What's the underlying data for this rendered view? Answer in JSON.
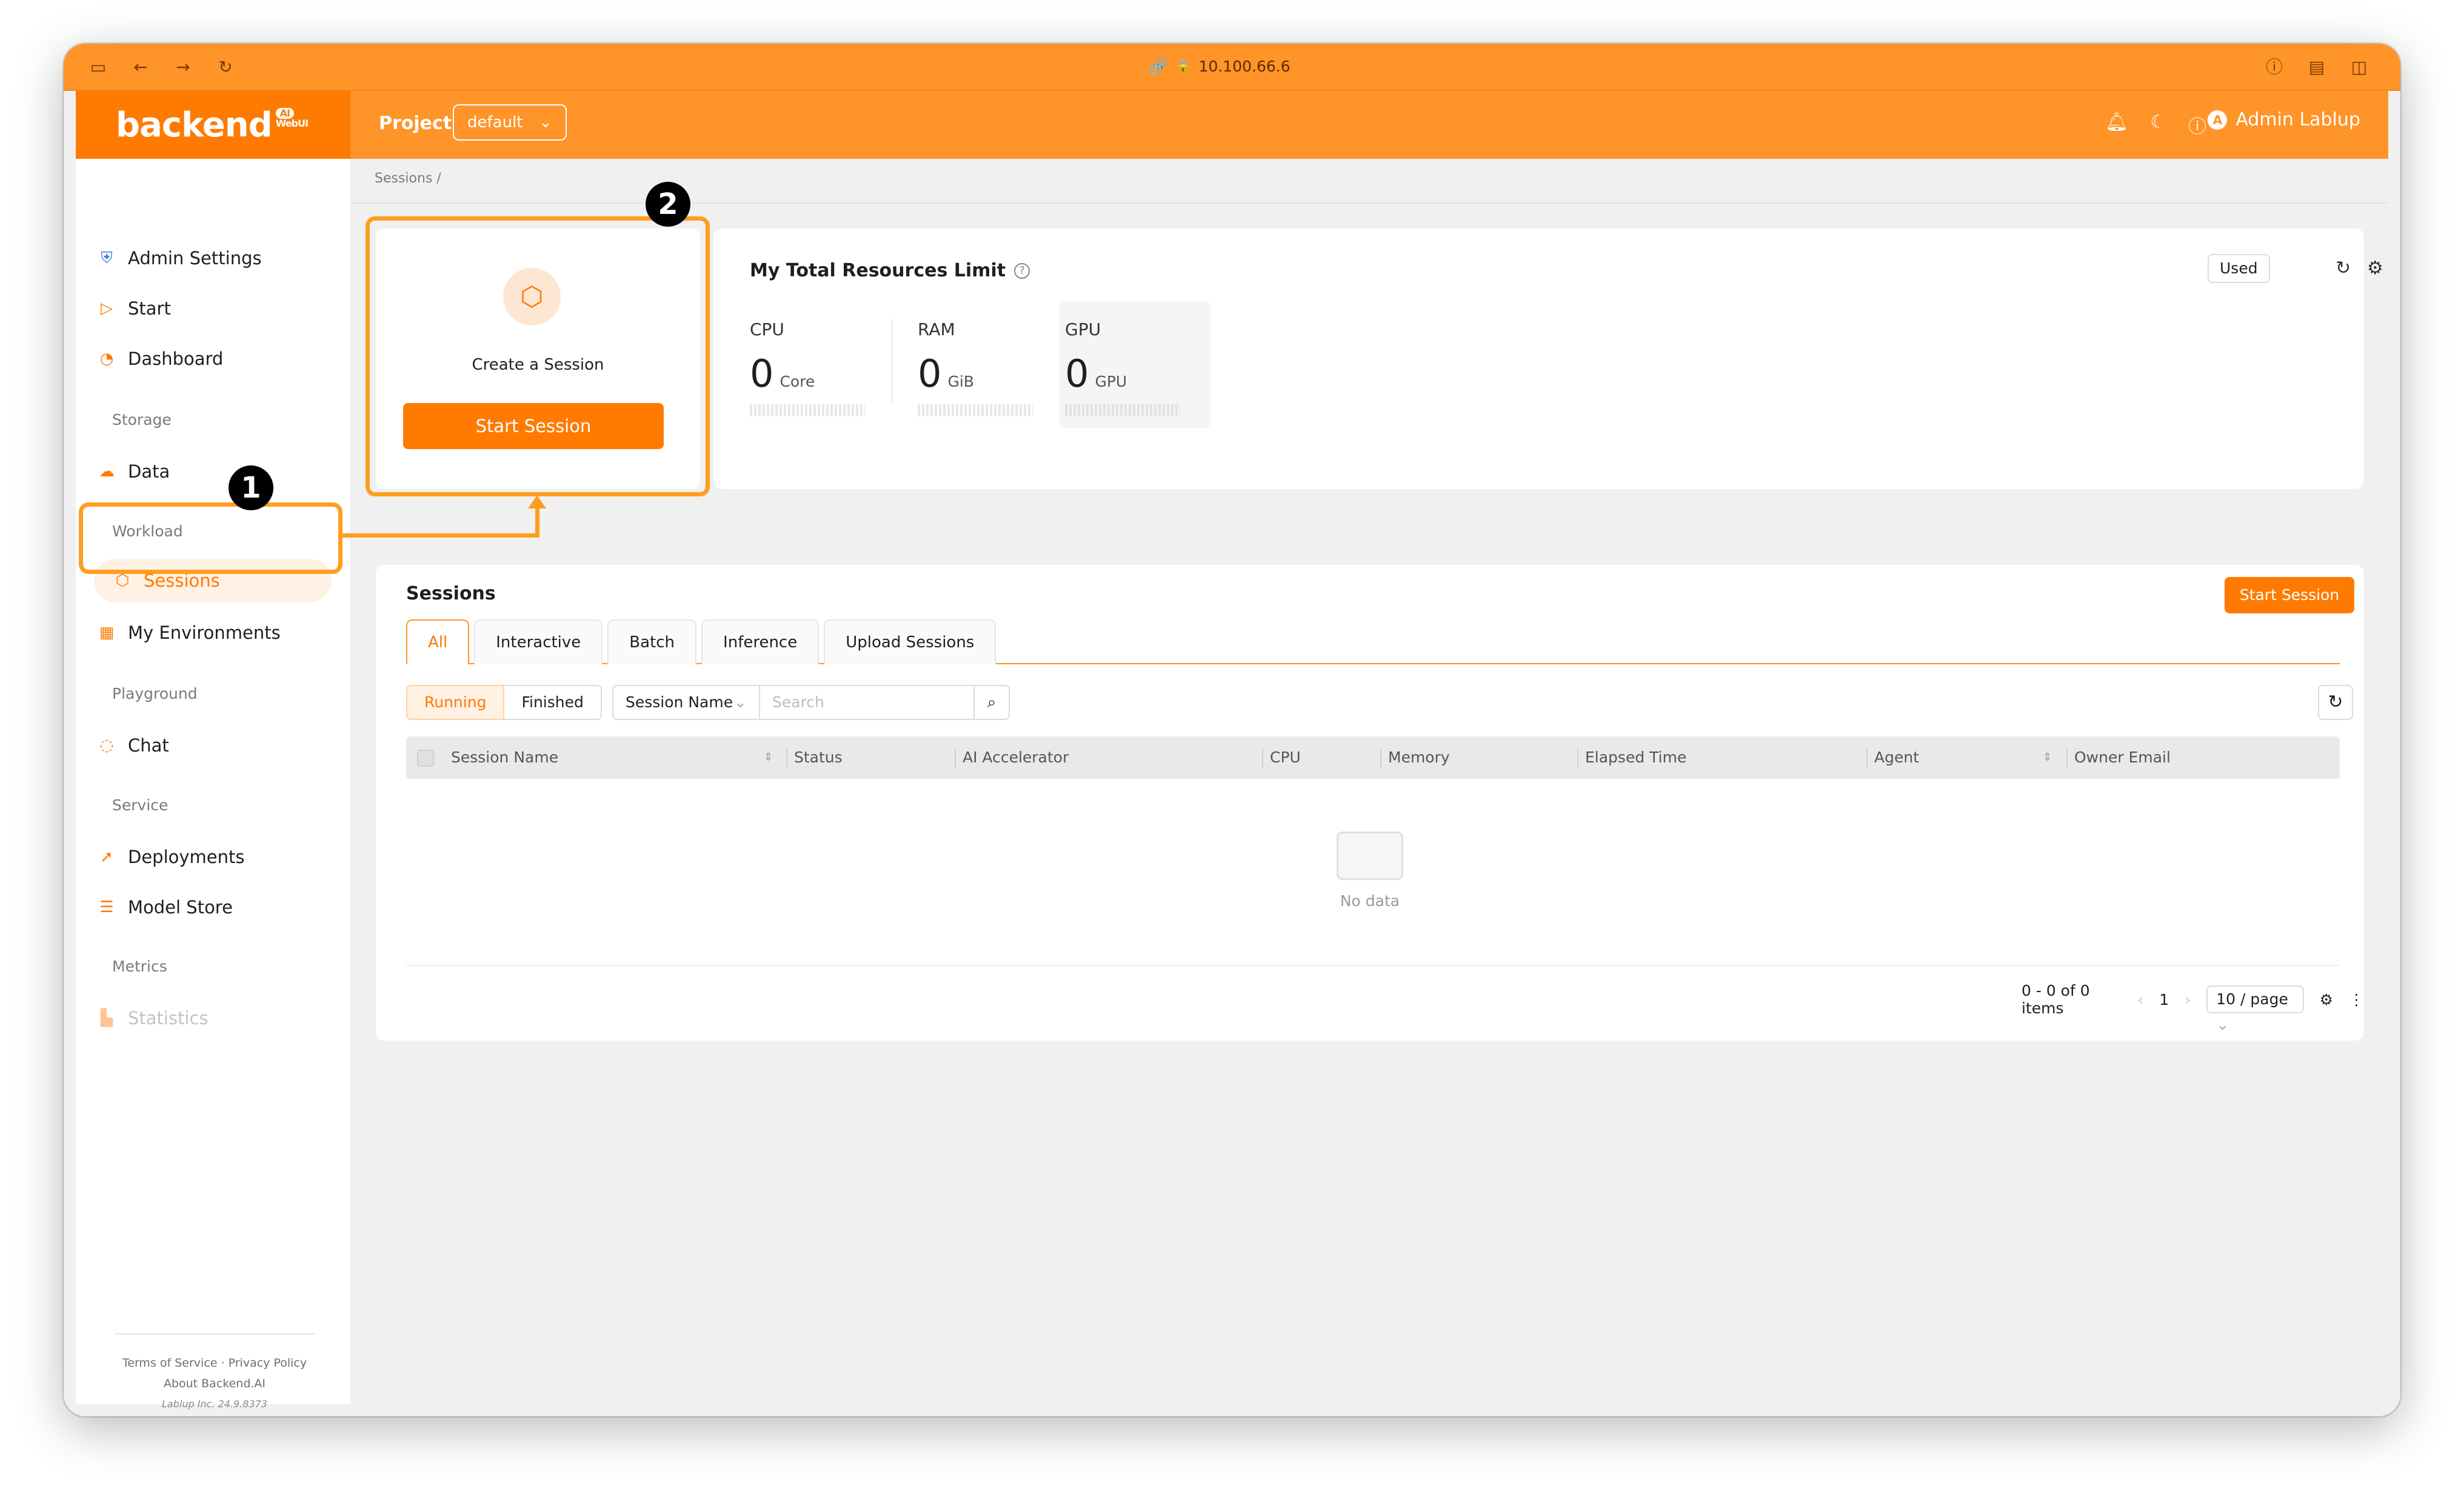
{
  "browser": {
    "url": "10.100.66.6"
  },
  "header": {
    "logo": "backend",
    "logo_ai": "AI",
    "logo_sub": "WebUI",
    "project_label": "Project",
    "project_value": "default",
    "user_name": "Admin Lablup",
    "user_initial": "A"
  },
  "sidebar": {
    "items": [
      {
        "label": "Admin Settings"
      },
      {
        "label": "Start"
      },
      {
        "label": "Dashboard"
      },
      {
        "label": "Data"
      },
      {
        "label": "Sessions"
      },
      {
        "label": "My Environments"
      },
      {
        "label": "Chat"
      },
      {
        "label": "Deployments"
      },
      {
        "label": "Model Store"
      },
      {
        "label": "Statistics"
      }
    ],
    "sections": [
      "Storage",
      "Workload",
      "Playground",
      "Service",
      "Metrics"
    ],
    "footer": {
      "terms": "Terms of Service",
      "privacy": "Privacy Policy",
      "about": "About Backend.AI",
      "version": "Lablup Inc. 24.9.8373"
    }
  },
  "breadcrumb": "Sessions  /",
  "create_card": {
    "title": "Create a Session",
    "button": "Start Session"
  },
  "resources": {
    "title": "My Total Resources Limit",
    "mode": "Used",
    "items": [
      {
        "label": "CPU",
        "value": "0",
        "unit": "Core"
      },
      {
        "label": "RAM",
        "value": "0",
        "unit": "GiB"
      },
      {
        "label": "GPU",
        "value": "0",
        "unit": "GPU"
      }
    ]
  },
  "sessions": {
    "title": "Sessions",
    "start_button": "Start Session",
    "tabs": [
      "All",
      "Interactive",
      "Batch",
      "Inference",
      "Upload Sessions"
    ],
    "status_filter": [
      "Running",
      "Finished"
    ],
    "filter_field": "Session Name",
    "search_placeholder": "Search",
    "columns": [
      "Session Name",
      "Status",
      "AI Accelerator",
      "CPU",
      "Memory",
      "Elapsed Time",
      "Agent",
      "Owner Email"
    ],
    "empty_text": "No data",
    "pagination": {
      "summary": "0 - 0 of 0 items",
      "page": "1",
      "page_size": "10 / page"
    }
  },
  "annotations": {
    "badge1": "1",
    "badge2": "2"
  }
}
